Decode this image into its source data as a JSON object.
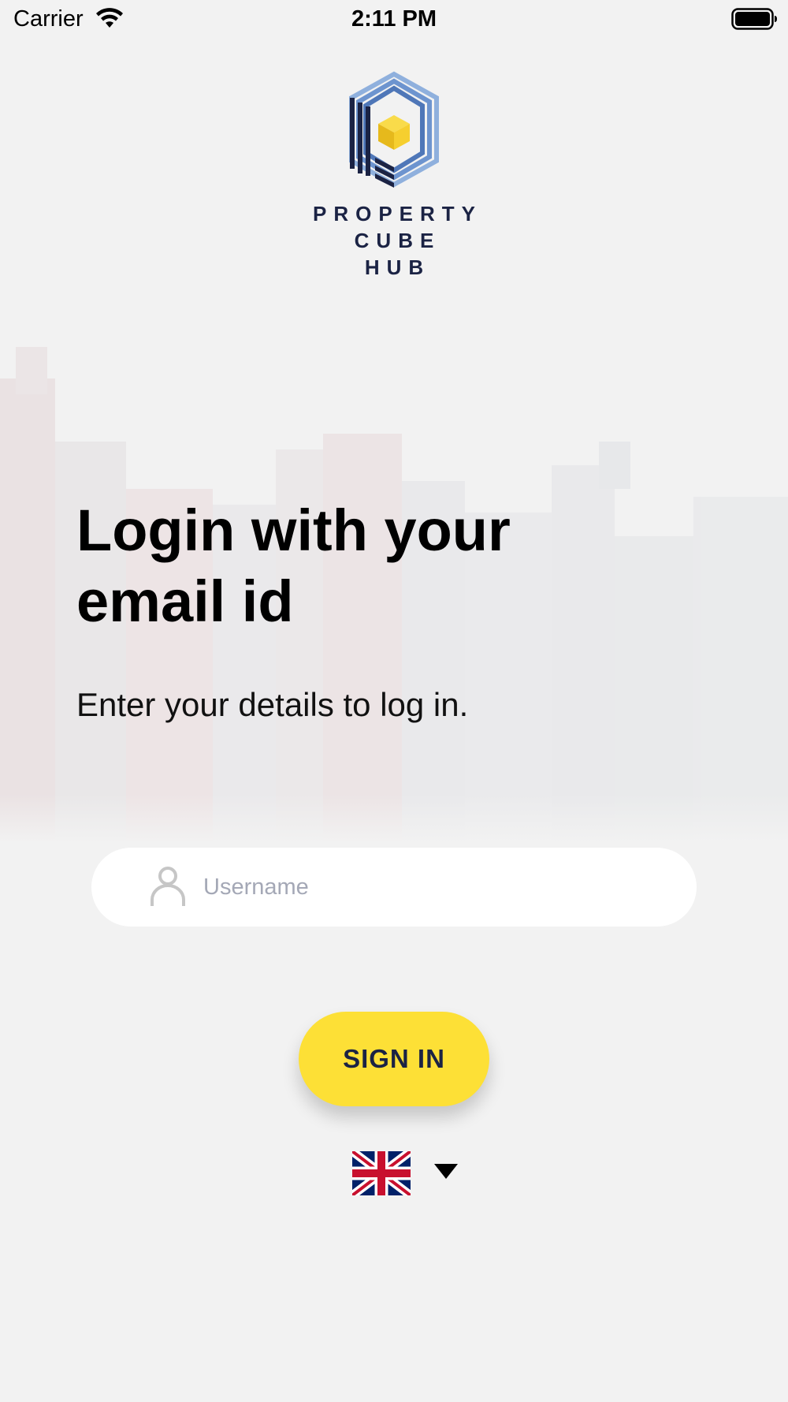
{
  "status_bar": {
    "carrier": "Carrier",
    "time": "2:11 PM",
    "icons": [
      "wifi-icon",
      "battery-icon"
    ]
  },
  "logo": {
    "line1": "PROPERTY",
    "line2": "CUBE",
    "line3": "HUB",
    "colors": {
      "navy": "#1b2344",
      "blue": "#5f86c4",
      "light_blue": "#8fb0dd",
      "yellow": "#f6cf2f"
    }
  },
  "login": {
    "title": "Login with your email id",
    "subtitle": "Enter your details to log in.",
    "username": {
      "value": "",
      "placeholder": "Username",
      "icon": "user-icon"
    },
    "sign_in_label": "SIGN IN"
  },
  "language": {
    "flag_icon": "uk-flag-icon",
    "caret_icon": "dropdown-caret-icon"
  },
  "colors": {
    "background": "#f2f2f2",
    "accent_yellow": "#fde036",
    "button_text": "#1b2344",
    "placeholder": "#a4a8b6"
  }
}
